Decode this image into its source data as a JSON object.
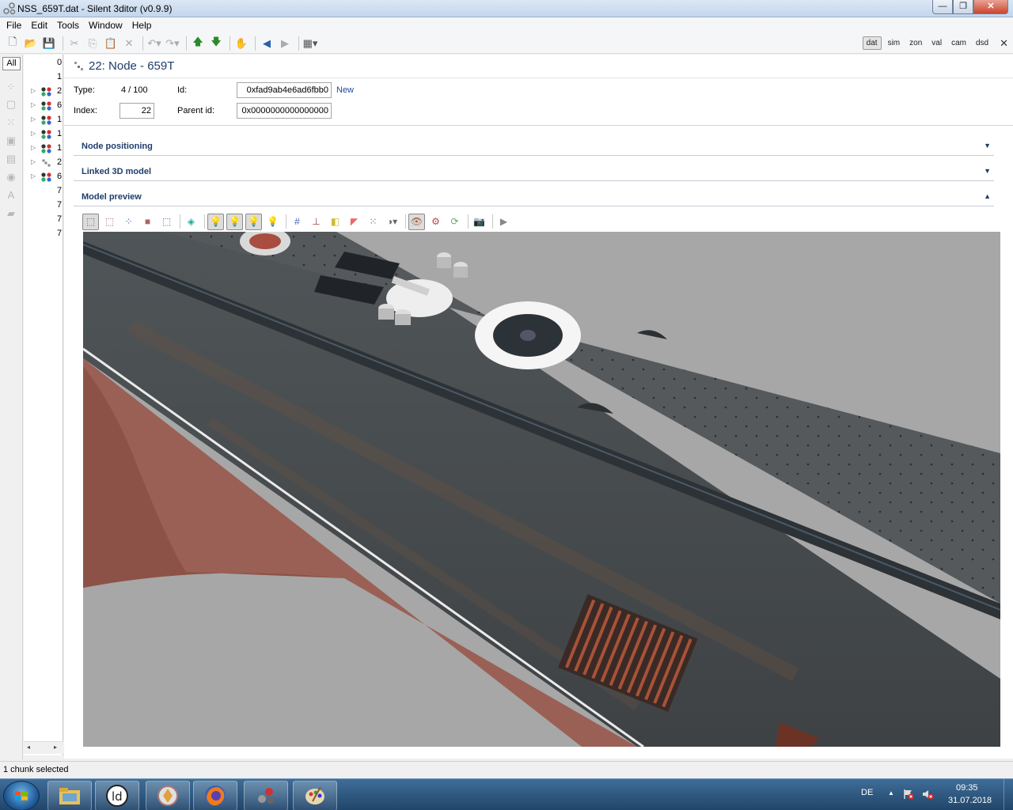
{
  "window": {
    "title": "NSS_659T.dat - Silent 3ditor (v0.9.9)",
    "minimize": "—",
    "restore": "❐",
    "close": "✕"
  },
  "menu": [
    "File",
    "Edit",
    "Tools",
    "Window",
    "Help"
  ],
  "view_tabs": {
    "items": [
      "dat",
      "sim",
      "zon",
      "val",
      "cam",
      "dsd"
    ],
    "active": "dat",
    "close": "✕"
  },
  "left_rail": {
    "all_label": "All"
  },
  "tree": {
    "rows": [
      {
        "num": "0",
        "expandable": false,
        "icon": "none"
      },
      {
        "num": "1",
        "expandable": false,
        "icon": "none"
      },
      {
        "num": "2",
        "expandable": true,
        "icon": "node-cluster-icon"
      },
      {
        "num": "6",
        "expandable": true,
        "icon": "node-cluster-icon"
      },
      {
        "num": "1",
        "expandable": true,
        "icon": "node-cluster-icon"
      },
      {
        "num": "1",
        "expandable": true,
        "icon": "node-cluster-icon"
      },
      {
        "num": "1",
        "expandable": true,
        "icon": "node-cluster-icon"
      },
      {
        "num": "2",
        "expandable": true,
        "icon": "node-single-icon"
      },
      {
        "num": "6",
        "expandable": true,
        "icon": "node-cluster-icon"
      },
      {
        "num": "7",
        "expandable": false,
        "icon": "none"
      },
      {
        "num": "7",
        "expandable": false,
        "icon": "none"
      },
      {
        "num": "7",
        "expandable": false,
        "icon": "none"
      },
      {
        "num": "7",
        "expandable": false,
        "icon": "none"
      }
    ],
    "scroll_left": "◂",
    "scroll_right": "▸"
  },
  "detail": {
    "title": "22: Node - 659T",
    "type_label": "Type:",
    "type_value": "4 / 100",
    "index_label": "Index:",
    "index_value": "22",
    "id_label": "Id:",
    "id_value": "0xfad9ab4e6ad6fbb0",
    "new_link": "New",
    "parent_label": "Parent id:",
    "parent_value": "0x0000000000000000"
  },
  "sections": [
    {
      "title": "Node positioning",
      "state": "collapsed",
      "arrow": "▼"
    },
    {
      "title": "Linked 3D model",
      "state": "collapsed",
      "arrow": "▼"
    },
    {
      "title": "Model preview",
      "state": "expanded",
      "arrow": "▲"
    }
  ],
  "status": {
    "text": "1 chunk selected"
  },
  "taskbar": {
    "buttons": [
      "file-explorer-icon",
      "ld-player-icon",
      "media-center-icon",
      "firefox-icon",
      "silent-3ditor-icon",
      "paint-icon"
    ],
    "lang": "DE",
    "time": "09:35",
    "date": "31.07.2018"
  },
  "colors": {
    "titlebar": "#c3d6ec",
    "accent_text": "#1e3d6b",
    "link": "#1f4aa0",
    "viewport_bg": "#a6a6a6",
    "hull": "#4a4f52",
    "hull_red": "#9a6055",
    "taskbar": "#2f5a82"
  }
}
